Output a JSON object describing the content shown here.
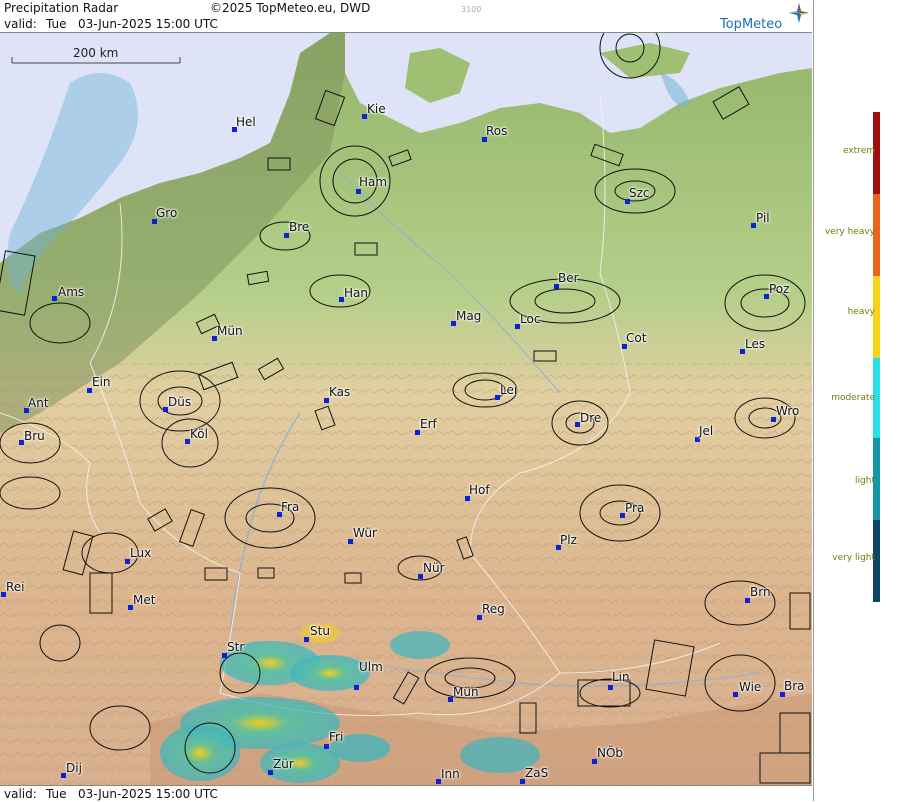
{
  "header": {
    "title": "Precipitation Radar",
    "copyright": "©2025 TopMeteo.eu, DWD",
    "code": "3100",
    "valid_prefix": "valid:",
    "valid_day": "Tue",
    "valid_datetime": "03-Jun-2025 15:00 UTC",
    "brand": "TopMeteo"
  },
  "footer": {
    "valid_prefix": "valid:",
    "valid_day": "Tue",
    "valid_datetime": "03-Jun-2025 15:00 UTC"
  },
  "scale_bar": {
    "label": "200 km"
  },
  "legend": {
    "items": [
      {
        "label": "extrem",
        "color": "#a30d0d"
      },
      {
        "label": "very heavy",
        "color": "#e8661c"
      },
      {
        "label": "heavy",
        "color": "#f7d41a"
      },
      {
        "label": "moderate",
        "color": "#29e0e6"
      },
      {
        "label": "light",
        "color": "#1795a8"
      },
      {
        "label": "very light",
        "color": "#0e4763"
      }
    ]
  },
  "colors": {
    "sea": "#dfe3f7",
    "lowland": "#9fbf72",
    "hills": "#e4c79a",
    "mountains": "#cfa07e",
    "city_dot": "#0a22d8",
    "brand_accent": "#1e6fb5"
  },
  "cities": [
    {
      "name": "Hel"
    },
    {
      "name": "Kie"
    },
    {
      "name": "Ros"
    },
    {
      "name": "Ham"
    },
    {
      "name": "Szc"
    },
    {
      "name": "Gro"
    },
    {
      "name": "Bre"
    },
    {
      "name": "Pil"
    },
    {
      "name": "Ams"
    },
    {
      "name": "Han"
    },
    {
      "name": "Ber"
    },
    {
      "name": "Poz"
    },
    {
      "name": "Mün"
    },
    {
      "name": "Mag"
    },
    {
      "name": "Loc"
    },
    {
      "name": "Cot"
    },
    {
      "name": "Les"
    },
    {
      "name": "Ein"
    },
    {
      "name": "Kas"
    },
    {
      "name": "Lei"
    },
    {
      "name": "Ant"
    },
    {
      "name": "Düs"
    },
    {
      "name": "Dre"
    },
    {
      "name": "Wro"
    },
    {
      "name": "Bru"
    },
    {
      "name": "Köl"
    },
    {
      "name": "Erf"
    },
    {
      "name": "Jel"
    },
    {
      "name": "Hof"
    },
    {
      "name": "Fra"
    },
    {
      "name": "Pra"
    },
    {
      "name": "Wür"
    },
    {
      "name": "Plz"
    },
    {
      "name": "Lux"
    },
    {
      "name": "Nür"
    },
    {
      "name": "Rei"
    },
    {
      "name": "Met"
    },
    {
      "name": "Reg"
    },
    {
      "name": "Brn"
    },
    {
      "name": "Stu"
    },
    {
      "name": "Str"
    },
    {
      "name": "Ulm"
    },
    {
      "name": "Lin"
    },
    {
      "name": "Mün"
    },
    {
      "name": "Wie"
    },
    {
      "name": "Bra"
    },
    {
      "name": "Fri"
    },
    {
      "name": "NÖb"
    },
    {
      "name": "Dij"
    },
    {
      "name": "Zür"
    },
    {
      "name": "Inn"
    },
    {
      "name": "ZaS"
    }
  ]
}
